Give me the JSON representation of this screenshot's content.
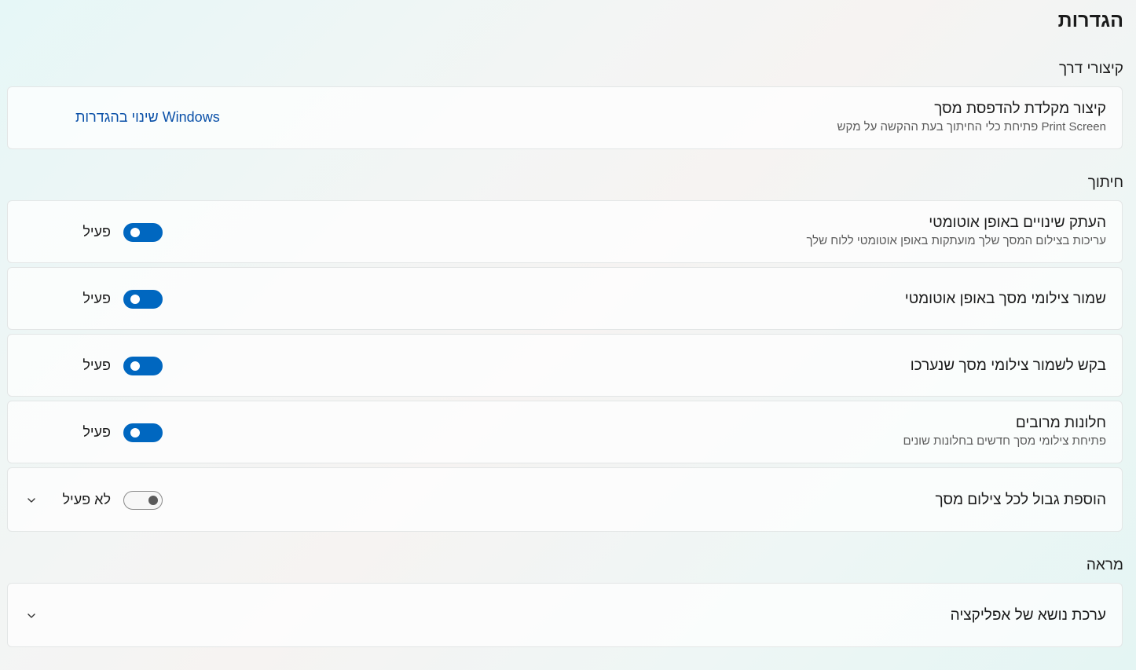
{
  "page": {
    "title": "הגדרות"
  },
  "sections": {
    "shortcuts": {
      "title": "קיצורי דרך"
    },
    "snipping": {
      "title": "חיתוך"
    },
    "appearance": {
      "title": "מראה"
    }
  },
  "print_screen": {
    "title": "קיצור מקלדת להדפסת מסך",
    "subtitle": "פתיחת כלי החיתוך בעת ההקשה על מקש Print Screen",
    "link": "שינוי בהגדרות Windows"
  },
  "auto_copy": {
    "title": "העתק שינויים באופן אוטומטי",
    "subtitle": "עריכות בצילום המסך שלך מועתקות באופן אוטומטי ללוח שלך",
    "state": "פעיל"
  },
  "auto_save": {
    "title": "שמור צילומי מסך באופן אוטומטי",
    "state": "פעיל"
  },
  "ask_save": {
    "title": "בקש לשמור צילומי מסך שנערכו",
    "state": "פעיל"
  },
  "multi_windows": {
    "title": "חלונות מרובים",
    "subtitle": "פתיחת צילומי מסך חדשים בחלונות שונים",
    "state": "פעיל"
  },
  "border": {
    "title": "הוספת גבול לכל צילום מסך",
    "state": "לא פעיל"
  },
  "theme": {
    "title": "ערכת נושא של אפליקציה"
  },
  "icons": {
    "expand": "chevron-down-icon"
  },
  "colors": {
    "accent": "#0067c0",
    "link": "#0a50a8"
  }
}
